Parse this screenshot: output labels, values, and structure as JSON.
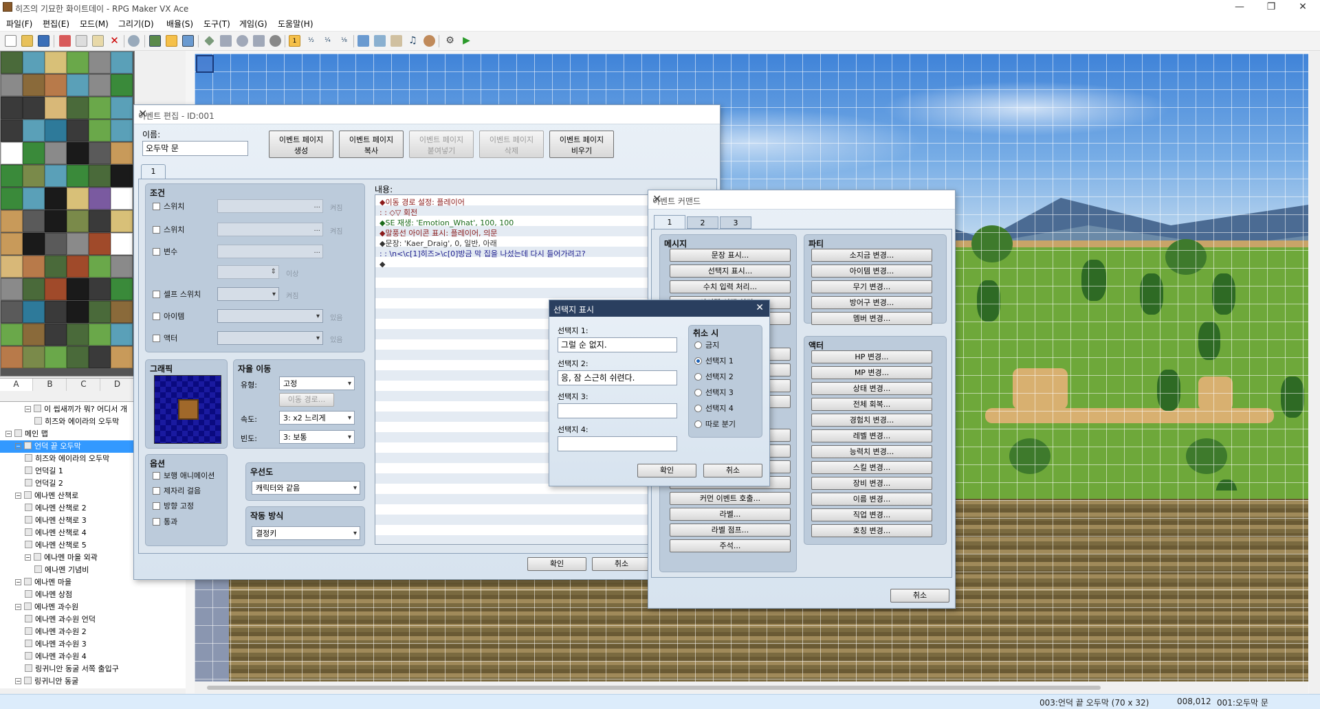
{
  "window": {
    "title": "히즈의 기묘한 화이트데이 - RPG Maker VX Ace"
  },
  "menu": [
    "파일(F)",
    "편집(E)",
    "모드(M)",
    "그리기(D)",
    "배율(S)",
    "도구(T)",
    "게임(G)",
    "도움말(H)"
  ],
  "tileset_tabs": [
    "A",
    "B",
    "C",
    "D"
  ],
  "tree": [
    {
      "label": "이 씹새끼가 뭐? 어디서 개",
      "depth": 2,
      "exp": "⊟"
    },
    {
      "label": "히즈와 에이라의 오두막",
      "depth": 3,
      "exp": ""
    },
    {
      "label": "메인 맵",
      "depth": 0,
      "exp": "⊟"
    },
    {
      "label": "언덕 끝 오두막",
      "depth": 1,
      "exp": "⊟",
      "sel": true
    },
    {
      "label": "히즈와 에이라의 오두막",
      "depth": 2,
      "exp": ""
    },
    {
      "label": "언덕길 1",
      "depth": 2,
      "exp": ""
    },
    {
      "label": "언덕길 2",
      "depth": 2,
      "exp": ""
    },
    {
      "label": "에나멘 산책로",
      "depth": 1,
      "exp": "⊟"
    },
    {
      "label": "에나멘 산책로 2",
      "depth": 2,
      "exp": ""
    },
    {
      "label": "에나멘 산책로 3",
      "depth": 2,
      "exp": ""
    },
    {
      "label": "에나멘 산책로 4",
      "depth": 2,
      "exp": ""
    },
    {
      "label": "에나멘 산책로 5",
      "depth": 2,
      "exp": ""
    },
    {
      "label": "에나멘 마을 외곽",
      "depth": 2,
      "exp": "⊟"
    },
    {
      "label": "에나멘 기념비",
      "depth": 3,
      "exp": ""
    },
    {
      "label": "에나멘 마을",
      "depth": 1,
      "exp": "⊟"
    },
    {
      "label": "에나멘 상점",
      "depth": 2,
      "exp": ""
    },
    {
      "label": "에나멘 과수원",
      "depth": 1,
      "exp": "⊟"
    },
    {
      "label": "에나멘 과수원 언덕",
      "depth": 2,
      "exp": ""
    },
    {
      "label": "에나멘 과수원 2",
      "depth": 2,
      "exp": ""
    },
    {
      "label": "에나멘 과수원 3",
      "depth": 2,
      "exp": ""
    },
    {
      "label": "에나멘 과수원 4",
      "depth": 2,
      "exp": ""
    },
    {
      "label": "링귀니안 동굴 서쪽 출입구",
      "depth": 2,
      "exp": ""
    },
    {
      "label": "링귀니안 동굴",
      "depth": 1,
      "exp": "⊟"
    },
    {
      "label": "링귀니안 동굴 1-1",
      "depth": 2,
      "exp": ""
    }
  ],
  "status": {
    "map": "003:언덕 끝 오두막 (70 x 32)",
    "coord": "008,012",
    "event": "001:오두막 문"
  },
  "event_editor": {
    "title": "이벤트 편집 - ID:001",
    "name_label": "이름:",
    "name_value": "오두막 문",
    "page_buttons": [
      {
        "l1": "이벤트 페이지",
        "l2": "생성",
        "dis": false
      },
      {
        "l1": "이벤트 페이지",
        "l2": "복사",
        "dis": false
      },
      {
        "l1": "이벤트 페이지",
        "l2": "붙여넣기",
        "dis": true
      },
      {
        "l1": "이벤트 페이지",
        "l2": "삭제",
        "dis": true
      },
      {
        "l1": "이벤트 페이지",
        "l2": "비우기",
        "dis": false
      }
    ],
    "page_tab": "1",
    "conditions": {
      "label": "조건",
      "switch1": "스위치",
      "switch2": "스위치",
      "variable": "변수",
      "self_switch": "셀프 스위치",
      "item": "아이템",
      "actor": "액터",
      "on1": "켜짐",
      "on2": "켜짐",
      "gte": "이상",
      "on3": "켜짐",
      "exists1": "있음",
      "exists2": "있음"
    },
    "graphic_label": "그래픽",
    "autonomous": {
      "label": "자율 이동",
      "type_label": "유형:",
      "type_value": "고정",
      "route_btn": "이동 경로...",
      "speed_label": "속도:",
      "speed_value": "3: x2 느리게",
      "freq_label": "빈도:",
      "freq_value": "3: 보통"
    },
    "options": {
      "label": "옵션",
      "walk_anim": "보행 애니메이션",
      "step_anim": "제자리 걸음",
      "dir_fix": "방향 고정",
      "through": "통과"
    },
    "priority": {
      "label": "우선도",
      "value": "캐릭터와 같음"
    },
    "trigger": {
      "label": "작동 방식",
      "value": "결정키"
    },
    "contents_label": "내용:",
    "commands": [
      {
        "t": "◆이동 경로 설정: 플레이어",
        "c": "#8b1a1a"
      },
      {
        "t": "  :                          : ◇▽ 회전",
        "c": "#8b1a1a"
      },
      {
        "t": "◆SE 재생: 'Emotion_What', 100, 100",
        "c": "#1a6a1a"
      },
      {
        "t": "◆말풍선 아이콘 표시: 플레이어, 의문",
        "c": "#8b1a1a"
      },
      {
        "t": "◆문장: 'Kaer_Draig', 0, 일반, 아래",
        "c": "#333"
      },
      {
        "t": "  :     : \\n<\\c[1]히즈>\\c[0]방금 막 집을 나섰는데 다시 들어가려고?",
        "c": "#1a1a8b"
      },
      {
        "t": "◆",
        "c": "#333"
      }
    ],
    "ok": "확인",
    "cancel": "취소"
  },
  "event_commands": {
    "title": "이벤트 커맨드",
    "tabs": [
      "1",
      "2",
      "3"
    ],
    "message_label": "메시지",
    "message_buttons": [
      "문장 표시...",
      "선택지 표시...",
      "수치 입력 처리...",
      "아이템 선택 처리..."
    ],
    "flow_buttons": [
      "이벤트 처리 중단",
      "커먼 이벤트 호출...",
      "라벨...",
      "라벨 점프...",
      "주석..."
    ],
    "party_label": "파티",
    "party_buttons": [
      "소지금 변경...",
      "아이템 변경...",
      "무기 변경...",
      "방어구 변경...",
      "멤버 변경..."
    ],
    "actor_label": "액터",
    "actor_buttons": [
      "HP 변경...",
      "MP 변경...",
      "상태 변경...",
      "전체 회복...",
      "경험치 변경...",
      "레벨 변경...",
      "능력치 변경...",
      "스킬 변경...",
      "장비 변경...",
      "이름 변경...",
      "직업 변경...",
      "호칭 변경..."
    ],
    "cancel": "취소"
  },
  "choices": {
    "title": "선택지 표시",
    "labels": [
      "선택지 1:",
      "선택지 2:",
      "선택지 3:",
      "선택지 4:"
    ],
    "values": [
      "그럴 순 없지.",
      "응, 잠 스근히 쉬련다.",
      "",
      ""
    ],
    "cancel_label": "취소 시",
    "cancel_options": [
      "금지",
      "선택지 1",
      "선택지 2",
      "선택지 3",
      "선택지 4",
      "따로 분기"
    ],
    "cancel_selected": 1,
    "ok": "확인",
    "cancel": "취소"
  }
}
